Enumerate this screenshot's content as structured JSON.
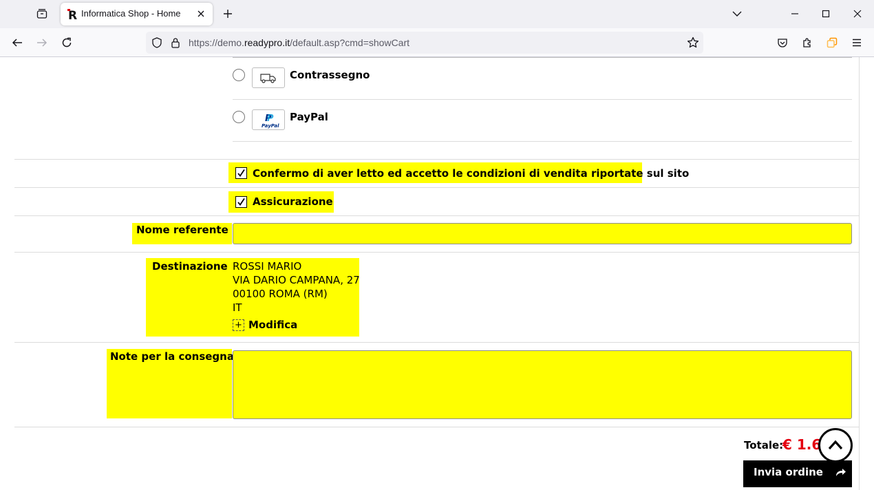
{
  "browser": {
    "tab_title": "Informatica Shop - Home",
    "url_prefix": "https://demo.",
    "url_host": "readypro.it",
    "url_path": "/default.asp?cmd=showCart"
  },
  "payment_options": [
    {
      "label": "Contrassegno",
      "icon": "delivery-truck-icon",
      "selected": false
    },
    {
      "label": "PayPal",
      "icon": "paypal-logo-icon",
      "selected": false
    }
  ],
  "paypal_logo_text": "PayPal",
  "checkboxes": {
    "terms": {
      "label": "Confermo di aver letto ed accetto le condizioni di vendita riportate sul sito",
      "checked": true
    },
    "insurance": {
      "label": "Assicurazione",
      "checked": true
    }
  },
  "form": {
    "referent_label": "Nome referente",
    "referent_value": "",
    "destination_label": "Destinazione",
    "destination_lines": [
      "ROSSI MARIO",
      "VIA DARIO CAMPANA, 27",
      "00100 ROMA (RM)",
      "IT"
    ],
    "edit_label": "Modifica",
    "edit_icon": "+",
    "notes_label": "Note per la consegna",
    "notes_value": ""
  },
  "summary": {
    "total_label": "Totale:",
    "total_value": "€ 1.62",
    "submit_label": "Invia ordine"
  },
  "colors": {
    "highlight": "#ffff00",
    "total": "#e4000f",
    "button_bg": "#000000"
  }
}
